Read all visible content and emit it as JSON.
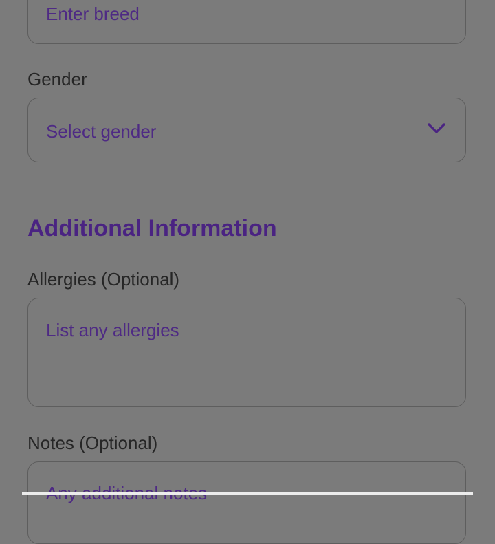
{
  "breed": {
    "placeholder": "Enter breed"
  },
  "gender": {
    "label": "Gender",
    "placeholder": "Select gender"
  },
  "additional": {
    "title": "Additional Information"
  },
  "allergies": {
    "label": "Allergies (Optional)",
    "placeholder": "List any allergies"
  },
  "notes": {
    "label": "Notes (Optional)",
    "placeholder": "Any additional notes"
  },
  "colors": {
    "accent": "#4a2382",
    "overlay": "#7b7b7b"
  },
  "icons": {
    "gender_dropdown": "chevron-down-icon"
  }
}
